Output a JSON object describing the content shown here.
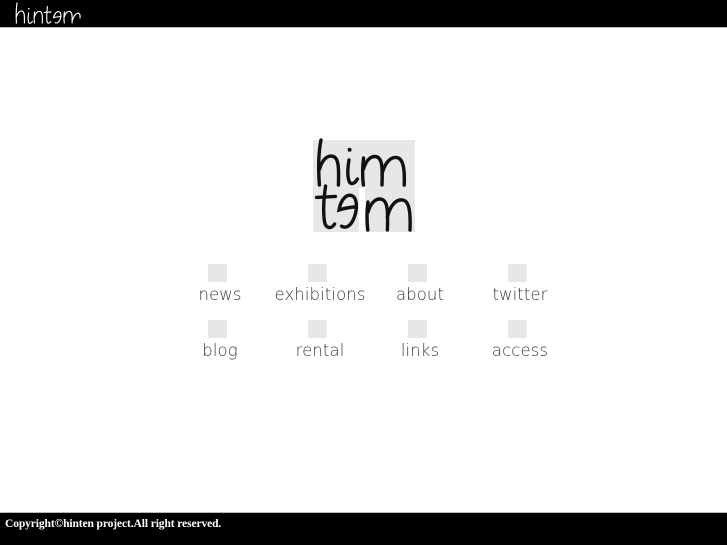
{
  "site": {
    "name": "hinten",
    "header_logo_text": "hinten",
    "center_logo_line1": "hin",
    "center_logo_line2": "ten"
  },
  "colors": {
    "header_bar": "#000000",
    "footer_bar": "#000000",
    "page_background": "#ffffff",
    "menu_square": "#e7e7e7",
    "logo_block": "#e7e7e7",
    "menu_label": "#3a3a3a",
    "rule": "#b9b9b9"
  },
  "menu": {
    "rows": [
      [
        {
          "label": "news",
          "icon": "gray-square-icon"
        },
        {
          "label": "exhibitions",
          "icon": "gray-square-icon"
        },
        {
          "label": "about",
          "icon": "gray-square-icon"
        },
        {
          "label": "twitter",
          "icon": "gray-square-icon"
        }
      ],
      [
        {
          "label": "blog",
          "icon": "gray-square-icon"
        },
        {
          "label": "rental",
          "icon": "gray-square-icon"
        },
        {
          "label": "links",
          "icon": "gray-square-icon"
        },
        {
          "label": "access",
          "icon": "gray-square-icon"
        }
      ]
    ]
  },
  "footer": {
    "copyright": "Copyright©hinten project.All right reserved."
  }
}
